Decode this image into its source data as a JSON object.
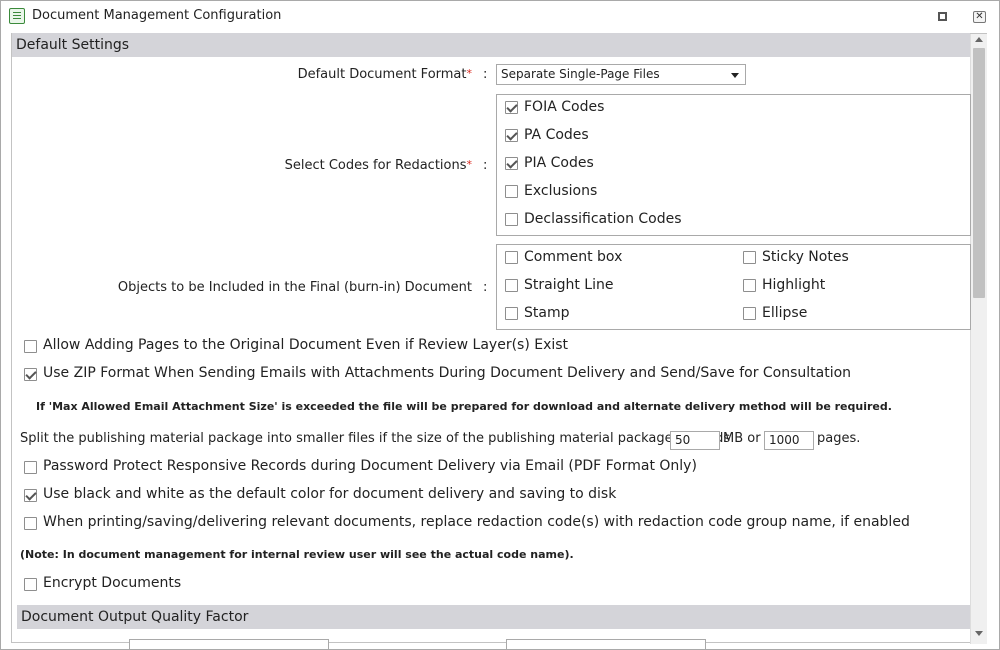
{
  "window": {
    "title": "Document Management Configuration"
  },
  "default_settings": {
    "header": "Default Settings",
    "format_label": "Default Document Format",
    "format_value": "Separate Single-Page Files",
    "codes_label": "Select Codes for Redactions",
    "codes": [
      {
        "label": "FOIA Codes",
        "checked": true
      },
      {
        "label": "PA Codes",
        "checked": true
      },
      {
        "label": "PIA Codes",
        "checked": true
      },
      {
        "label": "Exclusions",
        "checked": false
      },
      {
        "label": "Declassification Codes",
        "checked": false
      }
    ],
    "objects_label": "Objects to be Included in the Final (burn-in) Document",
    "objects": [
      {
        "label": "Comment box",
        "checked": false
      },
      {
        "label": "Sticky Notes",
        "checked": false
      },
      {
        "label": "Straight Line",
        "checked": false
      },
      {
        "label": "Highlight",
        "checked": false
      },
      {
        "label": "Stamp",
        "checked": false
      },
      {
        "label": "Ellipse",
        "checked": false
      }
    ],
    "colon": ":",
    "required_mark": "*"
  },
  "options": {
    "allow_adding_pages": {
      "label": "Allow Adding Pages to the Original Document Even if Review Layer(s) Exist",
      "checked": false
    },
    "use_zip": {
      "label": "Use ZIP Format When Sending Emails with Attachments During Document Delivery and Send/Save for Consultation",
      "checked": true
    },
    "zip_note": "If 'Max Allowed Email Attachment Size' is exceeded the file will be prepared for download and alternate delivery method will be required.",
    "split_text_1": "Split the publishing material package into smaller files if the size of the publishing material package exceeds",
    "split_mb_value": "50",
    "split_text_2": "MB or",
    "split_pages_value": "1000",
    "split_text_3": "pages.",
    "password_protect": {
      "label": "Password Protect Responsive Records during Document Delivery via Email (PDF Format Only)",
      "checked": false
    },
    "black_white": {
      "label": "Use black and white as the default color for document delivery and saving to disk",
      "checked": true
    },
    "replace_codes": {
      "label": "When printing/saving/delivering relevant documents, replace redaction code(s) with redaction code group name, if enabled",
      "checked": false
    },
    "internal_note": "(Note: In document management for internal review user will see the actual code name).",
    "encrypt": {
      "label": "Encrypt Documents",
      "checked": false
    }
  },
  "output_quality": {
    "header": "Document Output Quality Factor"
  }
}
